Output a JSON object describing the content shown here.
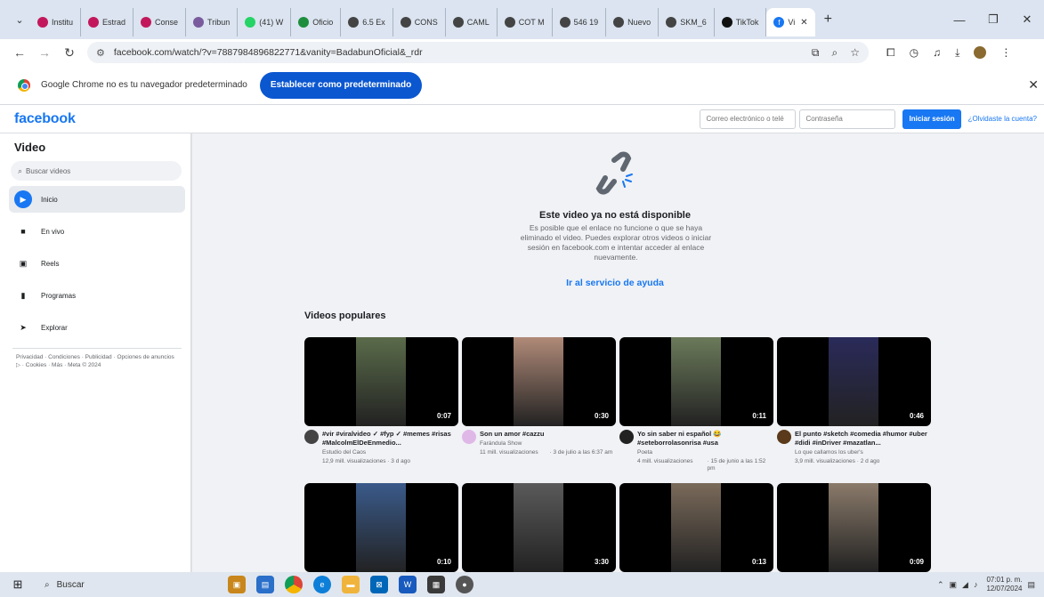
{
  "browser": {
    "tabs": [
      {
        "title": "Institu",
        "icon": "circle-logo-icon",
        "color": "#c2185b"
      },
      {
        "title": "Estrad",
        "icon": "circle-logo-icon",
        "color": "#c2185b"
      },
      {
        "title": "Conse",
        "icon": "circle-logo-icon",
        "color": "#c2185b"
      },
      {
        "title": "Tribun",
        "icon": "seal-icon",
        "color": "#7a5c9e"
      },
      {
        "title": "(41) W",
        "icon": "whatsapp-icon",
        "color": "#25d366"
      },
      {
        "title": "Oficio",
        "icon": "sheet-icon",
        "color": "#1e8e3e"
      },
      {
        "title": "6.5 Ex",
        "icon": "globe-icon",
        "color": "#444444"
      },
      {
        "title": "CONS",
        "icon": "globe-icon",
        "color": "#444444"
      },
      {
        "title": "CAML",
        "icon": "globe-icon",
        "color": "#444444"
      },
      {
        "title": "COT M",
        "icon": "globe-icon",
        "color": "#444444"
      },
      {
        "title": "546 19",
        "icon": "globe-icon",
        "color": "#444444"
      },
      {
        "title": "Nuevo",
        "icon": "globe-icon",
        "color": "#444444"
      },
      {
        "title": "SKM_6",
        "icon": "globe-icon",
        "color": "#444444"
      },
      {
        "title": "TikTok",
        "icon": "tiktok-icon",
        "color": "#111111"
      }
    ],
    "active_tab": {
      "title": "Vi",
      "icon": "facebook-icon",
      "color": "#1877f2"
    },
    "url": "facebook.com/watch/?v=788798489682277​1&vanity=BadabunOficial&_rdr",
    "infobar": {
      "text": "Google Chrome no es tu navegador predeterminado",
      "button": "Establecer como predeterminado"
    }
  },
  "fb": {
    "logo": "facebook",
    "email_placeholder": "Correo electrónico o telé",
    "password_placeholder": "Contraseña",
    "login_button": "Iniciar sesión",
    "forgot_link": "¿Olvidaste la cuenta?"
  },
  "sidebar": {
    "title": "Video",
    "search_placeholder": "Buscar videos",
    "items": [
      {
        "label": "Inicio",
        "icon": "home-play-icon",
        "active": true
      },
      {
        "label": "En vivo",
        "icon": "live-camera-icon",
        "active": false
      },
      {
        "label": "Reels",
        "icon": "reels-icon",
        "active": false
      },
      {
        "label": "Programas",
        "icon": "shows-icon",
        "active": false
      },
      {
        "label": "Explorar",
        "icon": "explore-icon",
        "active": false
      }
    ],
    "footer": "Privacidad · Condiciones · Publicidad · Opciones de anuncios ▷ · Cookies · Más · Meta © 2024"
  },
  "main": {
    "unavailable_title": "Este video ya no está disponible",
    "unavailable_text": "Es posible que el enlace no funcione o que se haya eliminado el video. Puedes explorar otros videos o iniciar sesión en facebook.com e intentar acceder al enlace nuevamente.",
    "help_link": "Ir al servicio de ayuda",
    "popular_title": "Videos populares",
    "videos": [
      {
        "duration": "0:07",
        "title": "#vir #viralvideo ✓ #fyp ✓ #memes #risas #MalcolmElDeEnmedio...",
        "channel": "Estudio del Caos",
        "stats": "12,9 mill. visualizaciones · 3 d ago",
        "thumb_color": "#5a6b4a",
        "avatar_color": "#444444"
      },
      {
        "duration": "0:30",
        "title": "Son un amor #cazzu",
        "channel": "Farándula Show",
        "views": "11 mill. visualizaciones",
        "date": "· 3 de julio a las 6:37 am",
        "thumb_color": "#b08a78",
        "avatar_color": "#e0b8e8"
      },
      {
        "duration": "0:11",
        "title": "Yo sin saber ni español 😂 #seteborrolasonrisa #usa",
        "channel": "Poeta",
        "views": "4 mill. visualizaciones",
        "date": "· 15 de junio a las 1:52 pm",
        "thumb_color": "#6b7a5a",
        "avatar_color": "#222222"
      },
      {
        "duration": "0:46",
        "title": "El punto #sketch #comedia #humor #uber #didi #inDriver #mazatlan...",
        "channel": "Lo que callamos los uber's",
        "stats": "3,9 mill. visualizaciones · 2 d ago",
        "thumb_color": "#2a2a5a",
        "avatar_color": "#5a3a1a"
      },
      {
        "duration": "0:10",
        "title": "",
        "channel": "",
        "stats": "",
        "thumb_color": "#3a5a8a",
        "avatar_color": "#000000"
      },
      {
        "duration": "3:30",
        "title": "",
        "channel": "",
        "stats": "",
        "thumb_color": "#5a5a5a",
        "avatar_color": "#000000"
      },
      {
        "duration": "0:13",
        "title": "",
        "channel": "",
        "stats": "",
        "thumb_color": "#7a6a5a",
        "avatar_color": "#000000"
      },
      {
        "duration": "0:09",
        "title": "",
        "channel": "",
        "stats": "",
        "thumb_color": "#8a7a6a",
        "avatar_color": "#000000"
      }
    ]
  },
  "taskbar": {
    "search_placeholder": "Buscar",
    "time": "07:01 p. m.",
    "date": "12/07/2024"
  }
}
